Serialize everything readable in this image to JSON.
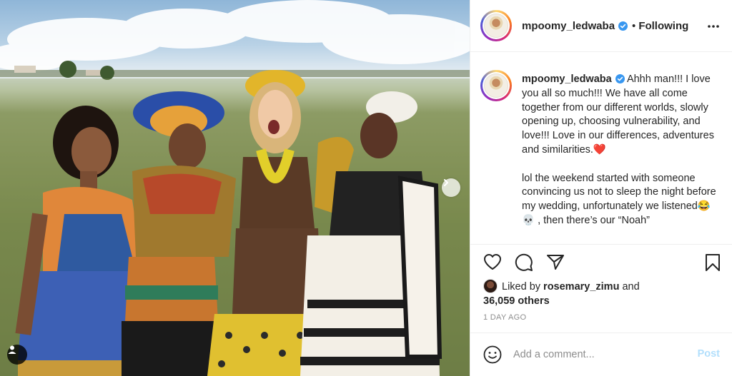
{
  "post": {
    "username": "mpoomy_ledwaba",
    "follow_separator": "•",
    "follow_status": "Following",
    "caption": "Ahhh man!!! I love you all so much!!! We have all come together from our different worlds, slowly opening up, choosing vulnerability, and love!!! Love in our differences, adventures and similarities.❤️\n\nlol the weekend started with someone convincing us not to sleep the night before my wedding, unfortunately we listened😂💀 , then there’s our “Noah”",
    "liked_by_prefix": "Liked by",
    "liked_by_user": "rosemary_zimu",
    "liked_by_and": "and",
    "others_count": "36,059 others",
    "time_ago": "1 DAY AGO",
    "comment_placeholder": "Add a comment...",
    "post_button": "Post"
  },
  "icons": {
    "verified": "verified-badge-icon",
    "more": "more-options-icon",
    "like": "heart-icon",
    "comment": "comment-icon",
    "share": "share-icon",
    "save": "bookmark-icon",
    "emoji": "smile-icon",
    "tag": "user-tag-icon",
    "next": "chevron-right-icon"
  },
  "colors": {
    "verified_blue": "#3897f0",
    "post_button_disabled": "#b2dffc",
    "muted_text": "#8e8e8e"
  }
}
